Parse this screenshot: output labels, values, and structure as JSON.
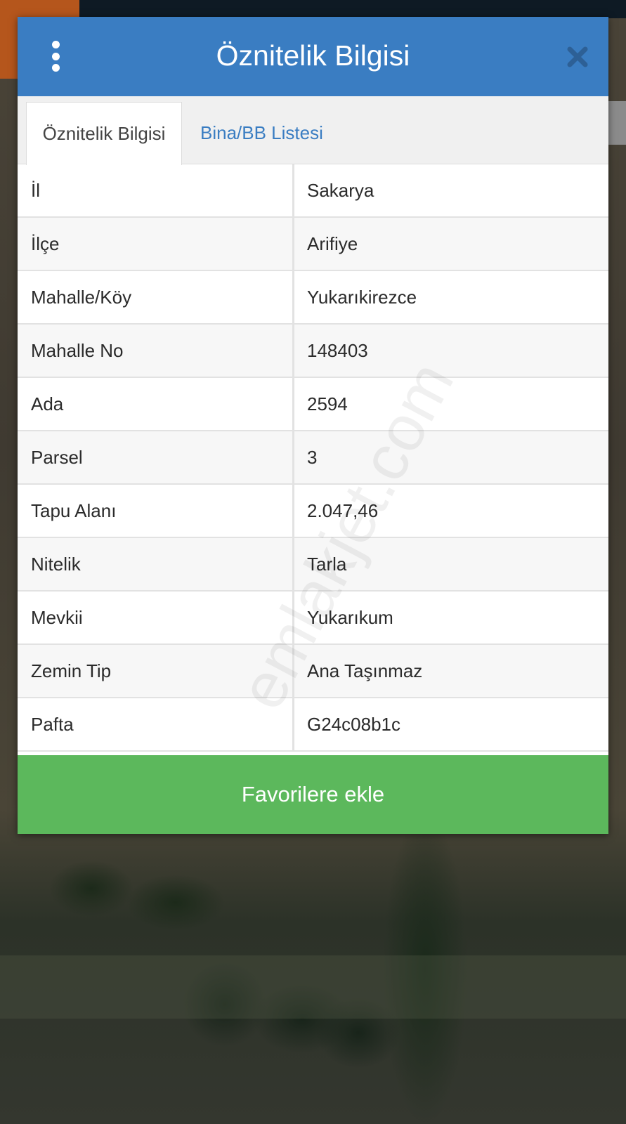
{
  "dialog": {
    "title": "Öznitelik Bilgisi",
    "tabs": [
      {
        "label": "Öznitelik Bilgisi",
        "active": true
      },
      {
        "label": "Bina/BB Listesi",
        "active": false
      }
    ],
    "rows": [
      {
        "key": "İl",
        "value": "Sakarya"
      },
      {
        "key": "İlçe",
        "value": "Arifiye"
      },
      {
        "key": "Mahalle/Köy",
        "value": "Yukarıkirezce"
      },
      {
        "key": "Mahalle No",
        "value": "148403"
      },
      {
        "key": "Ada",
        "value": "2594"
      },
      {
        "key": "Parsel",
        "value": "3"
      },
      {
        "key": "Tapu Alanı",
        "value": "2.047,46"
      },
      {
        "key": "Nitelik",
        "value": "Tarla"
      },
      {
        "key": "Mevkii",
        "value": "Yukarıkum"
      },
      {
        "key": "Zemin Tip",
        "value": "Ana Taşınmaz"
      },
      {
        "key": "Pafta",
        "value": "G24c08b1c"
      }
    ],
    "favorite_button": "Favorilere ekle"
  },
  "watermark": "emlakjet.com",
  "icons": {
    "menu": "more-vertical-icon",
    "close": "close-icon"
  },
  "colors": {
    "header": "#3a7dc2",
    "button": "#5cb85c",
    "tab_link": "#3a7dc2"
  }
}
